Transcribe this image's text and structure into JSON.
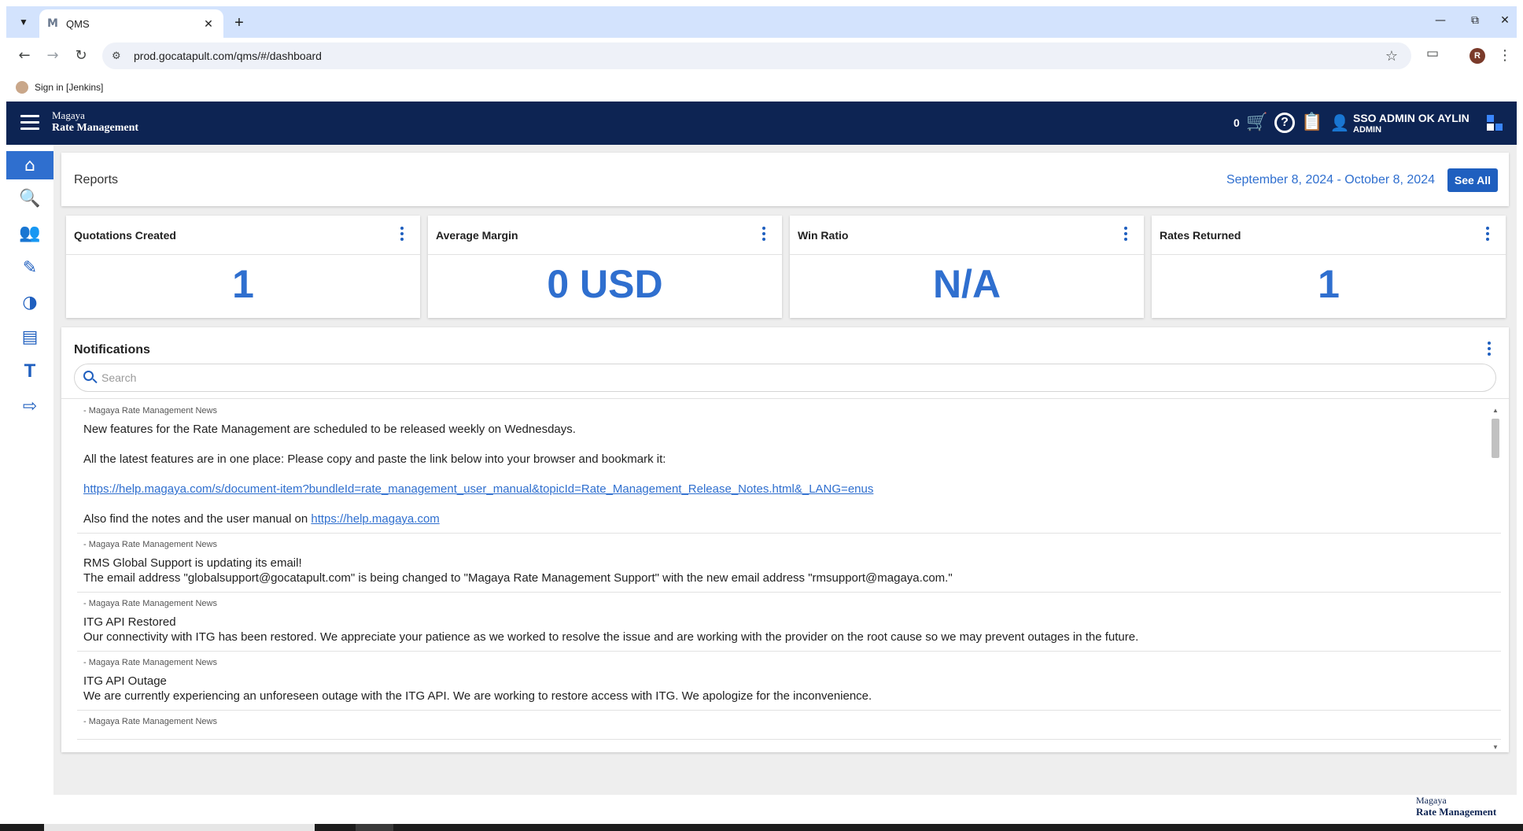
{
  "browser": {
    "tab_title": "QMS",
    "tab_favicon": "M",
    "url": "prod.gocatapult.com/qms/#/dashboard",
    "profile_initial": "R",
    "bookmark_label": "Sign in [Jenkins]"
  },
  "app": {
    "brand_top": "Magaya",
    "brand_bottom": "Rate Management",
    "cart_count": "0",
    "user_name": "SSO ADMIN OK AYLIN",
    "user_role": "ADMIN",
    "accent_color": "#2f6fcf",
    "header_color": "#0d2453"
  },
  "sidebar": {
    "items": [
      {
        "icon": "home-icon",
        "active": true
      },
      {
        "icon": "search-icon"
      },
      {
        "icon": "users-icon"
      },
      {
        "icon": "edit-icon"
      },
      {
        "icon": "pie-chart-icon"
      },
      {
        "icon": "message-icon"
      },
      {
        "icon": "text-icon",
        "glyph": "T"
      },
      {
        "icon": "exit-icon"
      }
    ]
  },
  "reports": {
    "title": "Reports",
    "date_range": "September 8, 2024 - October 8, 2024",
    "see_all_label": "See All"
  },
  "kpis": [
    {
      "title": "Quotations Created",
      "value": "1"
    },
    {
      "title": "Average Margin",
      "value": "0 USD"
    },
    {
      "title": "Win Ratio",
      "value": "N/A"
    },
    {
      "title": "Rates Returned",
      "value": "1"
    }
  ],
  "notifications": {
    "title": "Notifications",
    "search_placeholder": "Search",
    "items": [
      {
        "source": "- Magaya Rate Management News",
        "line1": "New features for the Rate Management are scheduled to be released weekly on Wednesdays.",
        "line2": "All the latest features are in one place: Please copy and paste the link below into your browser and bookmark it:",
        "link1": "https://help.magaya.com/s/document-item?bundleId=rate_management_user_manual&topicId=Rate_Management_Release_Notes.html&_LANG=enus",
        "line3_prefix": "Also find the notes and the user manual on ",
        "link2": "https://help.magaya.com"
      },
      {
        "source": "- Magaya Rate Management News",
        "line1": "RMS Global Support is updating its email!",
        "line2": "The email address \"globalsupport@gocatapult.com\" is being changed to \"Magaya Rate Management Support\" with the new email address \"rmsupport@magaya.com.\""
      },
      {
        "source": "- Magaya Rate Management News",
        "line1": "ITG API Restored",
        "line2": "Our connectivity with ITG has been restored. We appreciate your patience as we worked to resolve the issue and are working with the provider on the root cause so we may prevent outages in the future."
      },
      {
        "source": "- Magaya Rate Management News",
        "line1": "ITG API Outage",
        "line2": "We are currently experiencing an unforeseen outage with the ITG API. We are working to restore access with ITG. We apologize for the inconvenience."
      },
      {
        "source": "- Magaya Rate Management News"
      }
    ]
  },
  "footer": {
    "brand_top": "Magaya",
    "brand_bottom": "Rate Management"
  }
}
